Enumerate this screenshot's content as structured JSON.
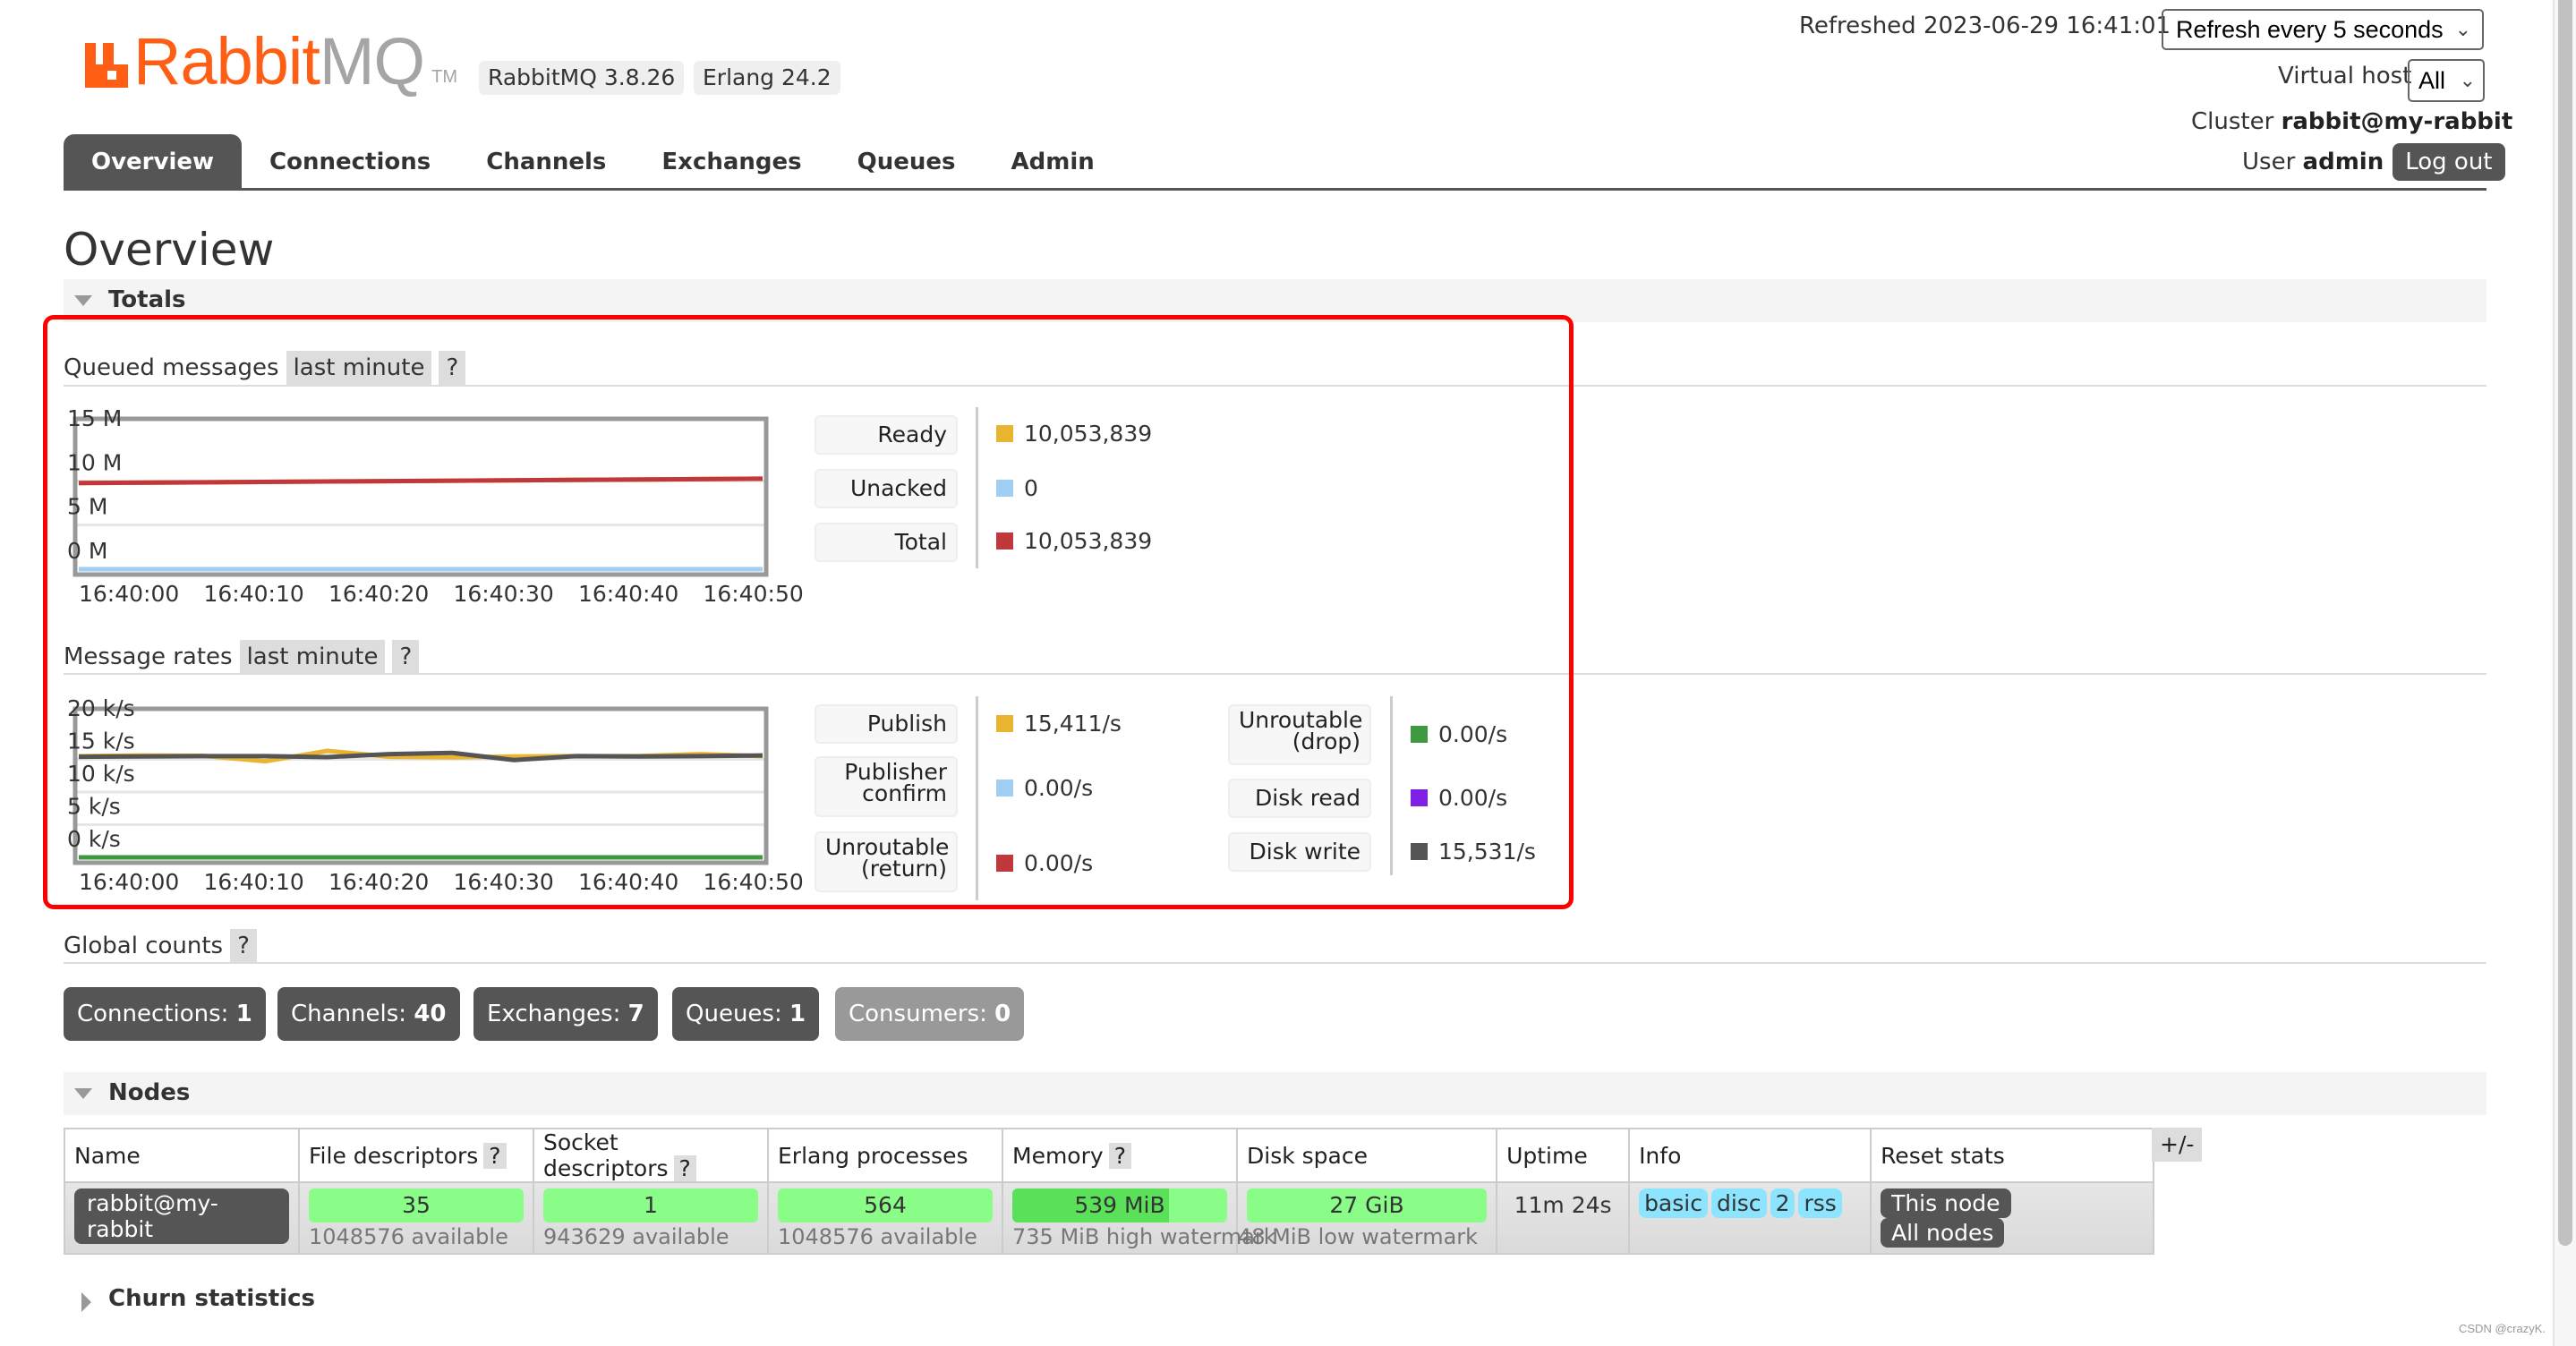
{
  "header": {
    "logo_brand": "Rabbit",
    "logo_suffix": "MQ",
    "logo_tm": "TM",
    "rabbitmq_version": "RabbitMQ 3.8.26",
    "erlang_version": "Erlang 24.2",
    "refreshed_text": "Refreshed 2023-06-29 16:41:01",
    "refresh_select_value": "Refresh every 5 seconds",
    "virtual_host_label": "Virtual host",
    "virtual_host_value": "All",
    "cluster_label": "Cluster",
    "cluster_name": "rabbit@my-rabbit",
    "user_label": "User",
    "user_name": "admin",
    "logout_label": "Log out"
  },
  "nav": {
    "tabs": [
      {
        "label": "Overview",
        "active": true
      },
      {
        "label": "Connections",
        "active": false
      },
      {
        "label": "Channels",
        "active": false
      },
      {
        "label": "Exchanges",
        "active": false
      },
      {
        "label": "Queues",
        "active": false
      },
      {
        "label": "Admin",
        "active": false
      }
    ]
  },
  "page": {
    "title": "Overview",
    "totals_label": "Totals",
    "nodes_label": "Nodes",
    "churn_label": "Churn statistics"
  },
  "queued_messages": {
    "title": "Queued messages",
    "range": "last minute",
    "help": "?",
    "legend": [
      {
        "label": "Ready",
        "value": "10,053,839",
        "color": "#e9b430"
      },
      {
        "label": "Unacked",
        "value": "0",
        "color": "#a0cff3"
      },
      {
        "label": "Total",
        "value": "10,053,839",
        "color": "#c0383c"
      }
    ]
  },
  "message_rates": {
    "title": "Message rates",
    "range": "last minute",
    "help": "?",
    "legend_left": [
      {
        "label": "Publish",
        "value": "15,411/s",
        "color": "#e9b430"
      },
      {
        "label": "Publisher confirm",
        "value": "0.00/s",
        "color": "#a0cff3"
      },
      {
        "label": "Unroutable (return)",
        "value": "0.00/s",
        "color": "#c0383c"
      }
    ],
    "legend_right": [
      {
        "label": "Unroutable (drop)",
        "value": "0.00/s",
        "color": "#3d9a40"
      },
      {
        "label": "Disk read",
        "value": "0.00/s",
        "color": "#7f1fe6"
      },
      {
        "label": "Disk write",
        "value": "15,531/s",
        "color": "#555555"
      }
    ]
  },
  "chart_data": [
    {
      "type": "line",
      "title": "Queued messages",
      "x": [
        "16:40:00",
        "16:40:10",
        "16:40:20",
        "16:40:30",
        "16:40:40",
        "16:40:50"
      ],
      "yticks": [
        "0 M",
        "5 M",
        "10 M",
        "15 M"
      ],
      "ylim": [
        0,
        15000000
      ],
      "grid": true,
      "series": [
        {
          "name": "Ready",
          "color": "#e9b430",
          "values": [
            9750000,
            9850000,
            9950000,
            10050000,
            10150000,
            10250000
          ]
        },
        {
          "name": "Unacked",
          "color": "#a0cff3",
          "values": [
            0,
            0,
            0,
            0,
            0,
            0
          ]
        },
        {
          "name": "Total",
          "color": "#c0383c",
          "values": [
            9750000,
            9850000,
            9950000,
            10050000,
            10150000,
            10250000
          ]
        }
      ]
    },
    {
      "type": "line",
      "title": "Message rates",
      "x": [
        "16:40:00",
        "16:40:05",
        "16:40:10",
        "16:40:15",
        "16:40:20",
        "16:40:25",
        "16:40:30",
        "16:40:35",
        "16:40:40",
        "16:40:45",
        "16:40:50",
        "16:40:55"
      ],
      "xticks": [
        "16:40:00",
        "16:40:10",
        "16:40:20",
        "16:40:30",
        "16:40:40",
        "16:40:50"
      ],
      "yticks": [
        "0 k/s",
        "5 k/s",
        "10 k/s",
        "15 k/s",
        "20 k/s"
      ],
      "ylim": [
        0,
        20000
      ],
      "grid": true,
      "series": [
        {
          "name": "Publish",
          "color": "#e9b430",
          "values": [
            15500,
            15600,
            15550,
            14700,
            16300,
            15400,
            15300,
            15450,
            15500,
            15500,
            15800,
            15500
          ]
        },
        {
          "name": "Disk write",
          "color": "#555555",
          "values": [
            15400,
            15450,
            15500,
            15500,
            15350,
            15800,
            16000,
            14900,
            15500,
            15450,
            15500,
            15600
          ]
        },
        {
          "name": "Disk read",
          "color": "#7f1fe6",
          "values": [
            0,
            0,
            0,
            0,
            0,
            0,
            0,
            0,
            0,
            0,
            0,
            0
          ]
        },
        {
          "name": "Publisher confirm",
          "color": "#a0cff3",
          "values": [
            0,
            0,
            0,
            0,
            0,
            0,
            0,
            0,
            0,
            0,
            0,
            0
          ]
        },
        {
          "name": "Unroutable (return)",
          "color": "#c0383c",
          "values": [
            0,
            0,
            0,
            0,
            0,
            0,
            0,
            0,
            0,
            0,
            0,
            0
          ]
        },
        {
          "name": "Unroutable (drop)",
          "color": "#3d9a40",
          "values": [
            0,
            0,
            0,
            0,
            0,
            0,
            0,
            0,
            0,
            0,
            0,
            0
          ]
        }
      ]
    }
  ],
  "global_counts": {
    "title": "Global counts",
    "help": "?",
    "items": [
      {
        "label": "Connections:",
        "value": "1",
        "dim": false
      },
      {
        "label": "Channels:",
        "value": "40",
        "dim": false
      },
      {
        "label": "Exchanges:",
        "value": "7",
        "dim": false
      },
      {
        "label": "Queues:",
        "value": "1",
        "dim": false
      },
      {
        "label": "Consumers:",
        "value": "0",
        "dim": true
      }
    ]
  },
  "nodes": {
    "columns": [
      "Name",
      "File descriptors",
      "Socket descriptors",
      "Erlang processes",
      "Memory",
      "Disk space",
      "Uptime",
      "Info",
      "Reset stats"
    ],
    "help": "?",
    "plus_minus": "+/-",
    "rows": [
      {
        "name": "rabbit@my-rabbit",
        "file_descriptors": "35",
        "file_descriptors_sub": "1048576 available",
        "socket_descriptors": "1",
        "socket_descriptors_sub": "943629 available",
        "erlang_processes": "564",
        "erlang_processes_sub": "1048576 available",
        "memory": "539 MiB",
        "memory_fraction": 0.73,
        "memory_sub": "735 MiB high watermark",
        "disk_space": "27 GiB",
        "disk_space_sub": "48 MiB low watermark",
        "uptime": "11m 24s",
        "info_badges": [
          "basic",
          "disc",
          "2",
          "rss"
        ],
        "reset_this": "This node",
        "reset_all": "All nodes"
      }
    ]
  },
  "watermark": "CSDN @crazyK."
}
